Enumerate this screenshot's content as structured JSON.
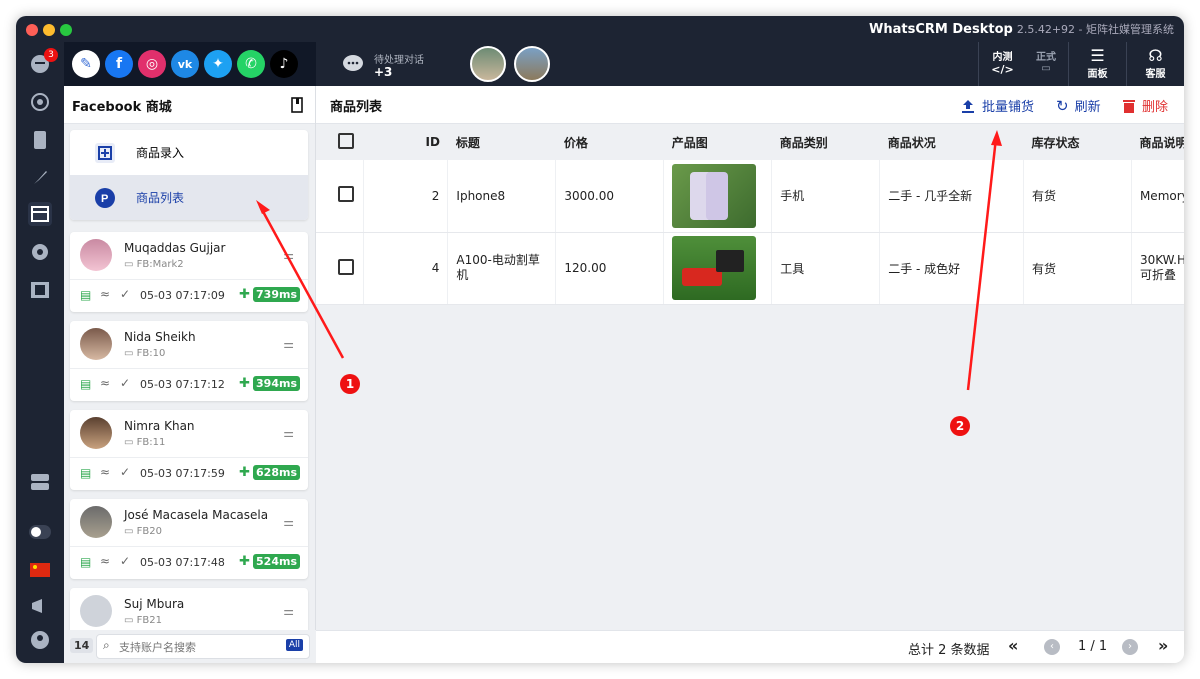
{
  "window": {
    "title": "WhatsCRM Desktop",
    "version": "2.5.42+92 - 矩阵社媒管理系统"
  },
  "rail": {
    "notify_count": "3"
  },
  "topbar": {
    "pending_label": "待处理对话",
    "pending_count": "+3",
    "tools": [
      {
        "top": "内测",
        "label": "正式"
      },
      {
        "label": "面板"
      },
      {
        "label": "客服"
      }
    ]
  },
  "left": {
    "title": "Facebook 商城",
    "menu": [
      {
        "label": "商品录入"
      },
      {
        "label": "商品列表"
      }
    ],
    "accounts": [
      {
        "name": "Muqaddas Gujjar",
        "fb": "FB:Mark2",
        "time": "05-03 07:17:09",
        "latency": "739ms"
      },
      {
        "name": "Nida Sheikh",
        "fb": "FB:10",
        "time": "05-03 07:17:12",
        "latency": "394ms"
      },
      {
        "name": "Nimra Khan",
        "fb": "FB:11",
        "time": "05-03 07:17:59",
        "latency": "628ms"
      },
      {
        "name": "José Macasela Macasela",
        "fb": "FB20",
        "time": "05-03 07:17:48",
        "latency": "524ms"
      },
      {
        "name": "Suj Mbura",
        "fb": "FB21"
      }
    ],
    "search": {
      "count": "14",
      "placeholder": "支持账户名搜索",
      "all": "All"
    }
  },
  "main": {
    "title": "商品列表",
    "actions": {
      "bulk": "批量铺货",
      "refresh": "刷新",
      "delete": "删除"
    },
    "columns": [
      "ID",
      "标题",
      "价格",
      "产品图",
      "商品类别",
      "商品状况",
      "库存状态",
      "商品说明"
    ],
    "rows": [
      {
        "id": "2",
        "title": "Iphone8",
        "price": "3000.00",
        "category": "手机",
        "condition": "二手 - 几乎全新",
        "stock": "有货",
        "desc": "Memory"
      },
      {
        "id": "4",
        "title": "A100-电动割草机",
        "price": "120.00",
        "category": "工具",
        "condition": "二手 - 成色好",
        "stock": "有货",
        "desc": "30KW.H 可折叠"
      }
    ],
    "footer": {
      "total": "总计 2 条数据",
      "page": "1 / 1"
    }
  },
  "annotations": {
    "marker1": "1",
    "marker2": "2"
  },
  "colors": {
    "accent": "#1a3fa8",
    "danger": "#e03030",
    "dark": "#1d2433",
    "success": "#2fa84f"
  }
}
